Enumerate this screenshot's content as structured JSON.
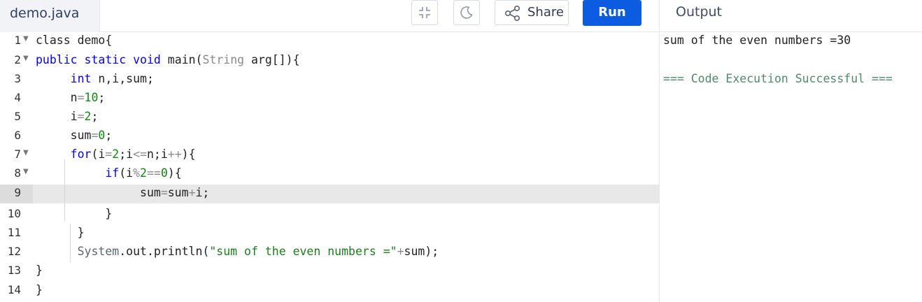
{
  "file_tab": {
    "label": "demo.java"
  },
  "toolbar": {
    "share_label": "Share",
    "run_label": "Run",
    "icons": [
      "minimize-icon",
      "moon-icon",
      "share-icon"
    ]
  },
  "output": {
    "title": "Output",
    "lines": [
      "sum of the even numbers =30",
      "=== Code Execution Successful ==="
    ]
  },
  "editor": {
    "active_line": 9,
    "line_numbers": [
      "1",
      "2",
      "3",
      "4",
      "5",
      "6",
      "7",
      "8",
      "9",
      "10",
      "11",
      "12",
      "13",
      "14"
    ],
    "lines": [
      "class demo{",
      "public static void main(String arg[]){",
      "    int n,i,sum;",
      "    n=10;",
      "    i=2;",
      "    sum=0;",
      "    for(i=2;i<=n;i++){",
      "        if(i%2==0){",
      "            sum=sum+i;",
      "        }",
      "     }",
      "     System.out.println(\"sum of the even numbers =\"+sum);",
      "}",
      "}"
    ]
  },
  "colors": {
    "run_button": "#0b5ce0",
    "keyword": "#0000ff",
    "number": "#0a8a0a",
    "success": "#4e8a6b"
  }
}
